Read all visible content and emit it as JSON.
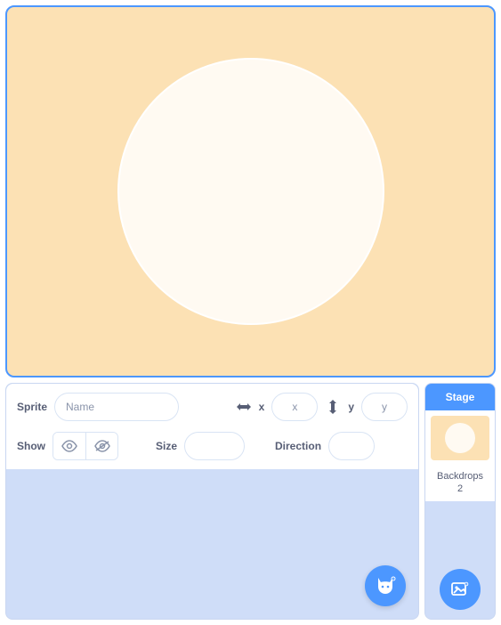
{
  "stage": {
    "header": "Stage",
    "backdrops_label": "Backdrops",
    "backdrops_count": "2"
  },
  "sprite": {
    "label": "Sprite",
    "name_placeholder": "Name",
    "x_label": "x",
    "x_value": "x",
    "y_label": "y",
    "y_value": "y",
    "show_label": "Show",
    "size_label": "Size",
    "size_value": "",
    "direction_label": "Direction",
    "direction_value": ""
  }
}
